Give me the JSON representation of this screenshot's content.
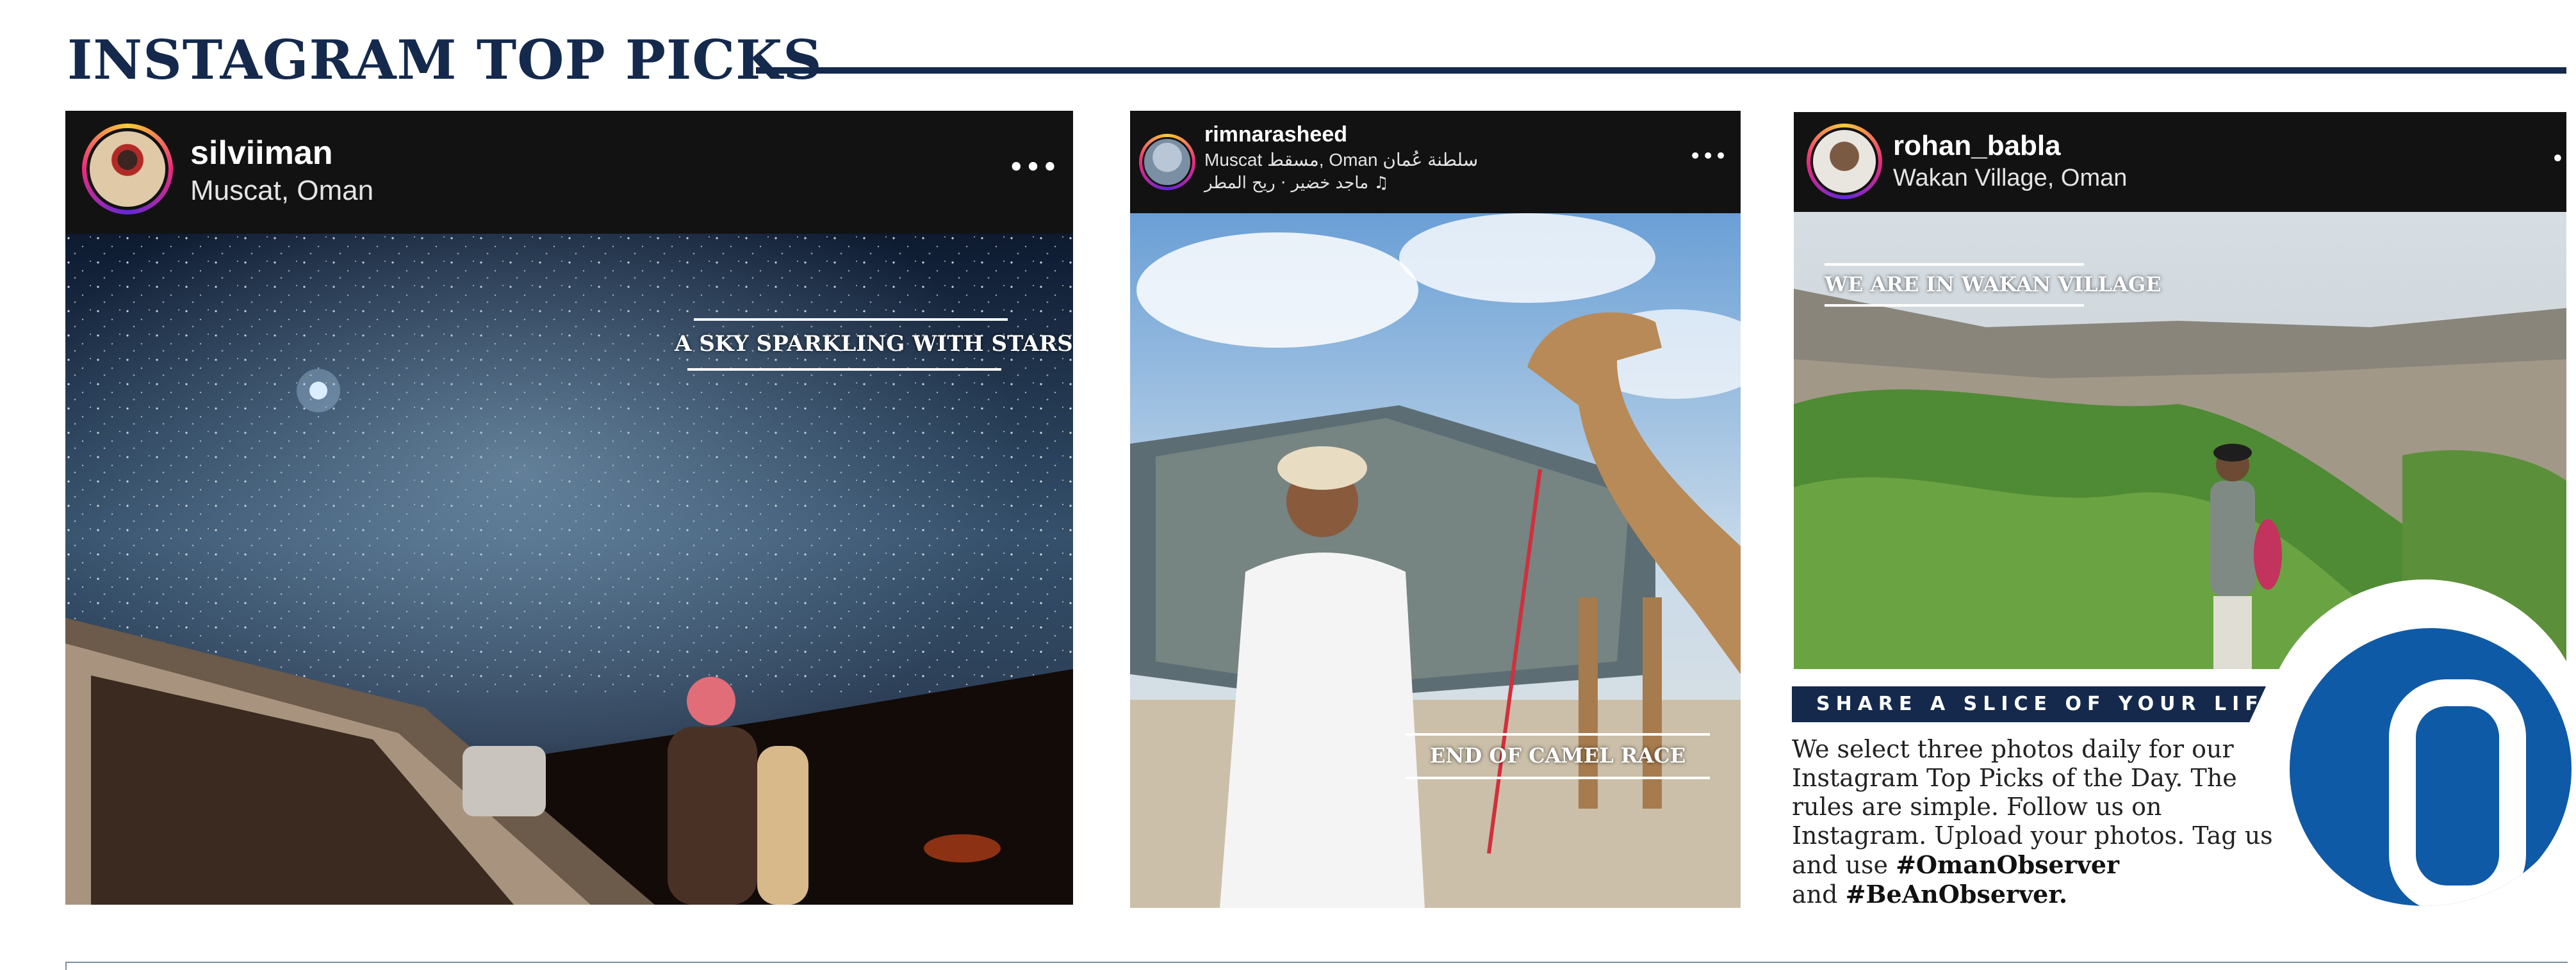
{
  "section": {
    "title": "INSTAGRAM TOP PICKS"
  },
  "posts": [
    {
      "username": "silviiman",
      "location": "Muscat, Oman",
      "more": "•••",
      "caption": "A SKY SPARKLING WITH STARS"
    },
    {
      "username": "rimnarasheed",
      "location": "Muscat مسقط, Oman سلطنة عُمان",
      "audio": "♫ ماجد خضير · ريح المطر",
      "more": "•••",
      "caption": "END OF CAMEL RACE"
    },
    {
      "username": "rohan_babla",
      "location": "Wakan Village, Oman",
      "more": "•",
      "caption": "WE ARE IN WAKAN  VILLAGE"
    }
  ],
  "share": {
    "heading": "SHARE A SLICE OF YOUR LIFE",
    "body_1": "We select three photos daily for our Instagram Top Picks of the Day. The rules are simple. Follow us on Instagram. Upload your photos. Tag us and use",
    "hashtag_1": "#OmanObserver",
    "and_text": "and",
    "hashtag_2": "#BeAnObserver."
  },
  "colors": {
    "navy": "#14294c",
    "brand_blue": "#0f5aa6",
    "instagram_header": "#121212"
  },
  "icons": [
    "more-options-icon",
    "music-note-icon",
    "observer-logo-icon"
  ]
}
